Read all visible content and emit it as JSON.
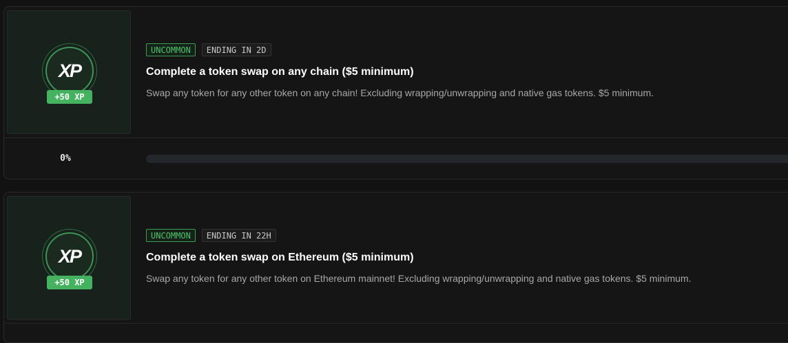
{
  "quests": [
    {
      "xp_logo": "XP",
      "xp_reward": "+50 XP",
      "rarity": "UNCOMMON",
      "ending": "ENDING IN 2D",
      "title": "Complete a token swap on any chain ($5 minimum)",
      "description": "Swap any token for any other token on any chain! Excluding wrapping/unwrapping and native gas tokens. $5 minimum.",
      "progress_label": "0%",
      "progress_value": 0
    },
    {
      "xp_logo": "XP",
      "xp_reward": "+50 XP",
      "rarity": "UNCOMMON",
      "ending": "ENDING IN 22H",
      "title": "Complete a token swap on Ethereum ($5 minimum)",
      "description": "Swap any token for any other token on Ethereum mainnet! Excluding wrapping/unwrapping and native gas tokens. $5 minimum."
    }
  ],
  "colors": {
    "accent_green": "#45b25f",
    "rarity_uncommon": "#4cc36a",
    "background": "#121212"
  }
}
